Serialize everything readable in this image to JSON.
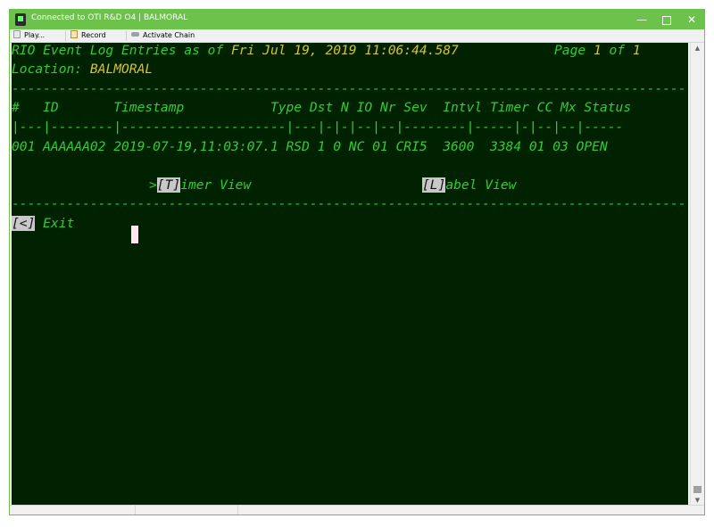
{
  "window": {
    "title": "Connected to OTI R&D O4 | BALMORAL",
    "minimize": "—",
    "close": "✕"
  },
  "toolbar": {
    "play_label": "Play...",
    "record_label": "Record",
    "activate_label": "Activate Chain"
  },
  "terminal": {
    "header_prefix": "RIO Event Log Entries as of ",
    "datetime": "Fri Jul 19, 2019 11:06:44.587",
    "page_prefix": "Page ",
    "page_current": "1",
    "page_of": " of ",
    "page_total": "1",
    "location_label": "Location: ",
    "location_value": "BALMORAL",
    "divider": "----------------------------------------------------------------------------------------------------",
    "column_headers": "#   ID       Timestamp           Type Dst N IO Nr Sev  Intvl Timer CC Mx Status",
    "column_rule": "|---|--------|---------------------|---|-|-|--|--|--------|-----|-|--|--|-----",
    "row_1": "001 AAAAAA02 2019-07-19,11:03:07.1 RSD 1 0 NC 01 CRI5  3600  3384 01 03 OPEN",
    "timer_prefix": ">",
    "timer_key": "[T]",
    "timer_rest": "imer View",
    "label_key": "[L]",
    "label_rest": "abel View",
    "exit_key": "[<]",
    "exit_label": " Exit"
  },
  "colors": {
    "terminal_bg": "#002200",
    "text_green": "#33cc33",
    "text_yellow": "#d9c22e",
    "titlebar": "#6cc24a"
  }
}
